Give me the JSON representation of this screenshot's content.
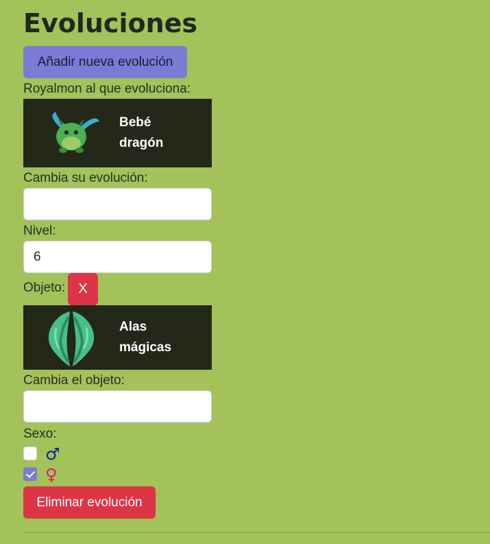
{
  "page": {
    "title": "Evoluciones",
    "add_button": "Añadir nueva evolución"
  },
  "evolution": {
    "target_label": "Royalmon al que evoluciona:",
    "target_name": "Bebé dragón",
    "change_evolution_label": "Cambia su evolución:",
    "change_evolution_value": "",
    "level_label": "Nivel:",
    "level_value": "6",
    "object_label": "Objeto:",
    "object_remove": "X",
    "object_name": "Alas mágicas",
    "change_object_label": "Cambia el objeto:",
    "change_object_value": "",
    "sex_label": "Sexo:",
    "sex_options": [
      {
        "symbol": "♂",
        "checked": false,
        "color": "#0b1fa3"
      },
      {
        "symbol": "♀",
        "checked": true,
        "color": "#e0187a"
      }
    ],
    "delete_button": "Eliminar evolución"
  },
  "colors": {
    "background": "#a3c25a",
    "card": "#232818",
    "primary": "#7b7bd6",
    "danger": "#dc3545"
  }
}
